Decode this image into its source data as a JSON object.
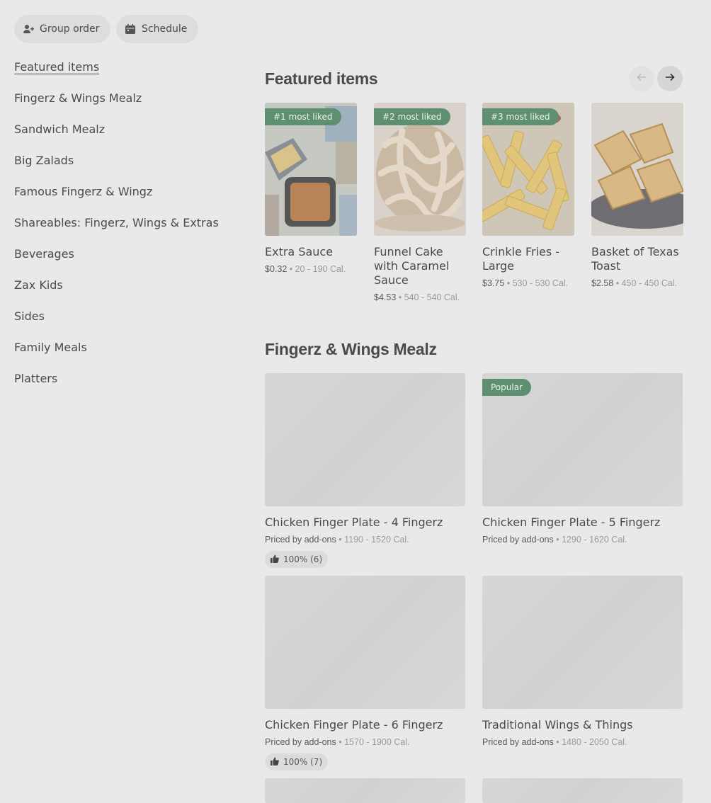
{
  "top_actions": {
    "group_order": "Group order",
    "schedule": "Schedule"
  },
  "sidebar": {
    "items": [
      {
        "label": "Featured items"
      },
      {
        "label": "Fingerz & Wings Mealz"
      },
      {
        "label": "Sandwich Mealz"
      },
      {
        "label": "Big Zalads"
      },
      {
        "label": "Famous Fingerz & Wingz"
      },
      {
        "label": "Shareables: Fingerz, Wings & Extras"
      },
      {
        "label": "Beverages"
      },
      {
        "label": "Zax Kids"
      },
      {
        "label": "Sides"
      },
      {
        "label": "Family Meals"
      },
      {
        "label": "Platters"
      }
    ]
  },
  "featured": {
    "title": "Featured items",
    "items": [
      {
        "badge": "#1 most liked",
        "name": "Extra Sauce",
        "price": "$0.32",
        "cal": "20 - 190 Cal."
      },
      {
        "badge": "#2 most liked",
        "name": "Funnel Cake with Caramel Sauce",
        "price": "$4.53",
        "cal": "540 - 540 Cal."
      },
      {
        "badge": "#3 most liked",
        "name": "Crinkle Fries - Large",
        "price": "$3.75",
        "cal": "530 - 530 Cal."
      },
      {
        "badge": "",
        "name": "Basket of Texas Toast",
        "price": "$2.58",
        "cal": "450 - 450 Cal."
      }
    ]
  },
  "fingerz_section": {
    "title": "Fingerz & Wings Mealz",
    "items": [
      {
        "badge": "",
        "name": "Chicken Finger Plate - 4 Fingerz",
        "price": "Priced by add-ons",
        "cal": "1190 - 1520 Cal.",
        "rating": "100% (6)"
      },
      {
        "badge": "Popular",
        "name": "Chicken Finger Plate - 5 Fingerz",
        "price": "Priced by add-ons",
        "cal": "1290 - 1620 Cal.",
        "rating": ""
      },
      {
        "badge": "",
        "name": "Chicken Finger Plate - 6 Fingerz",
        "price": "Priced by add-ons",
        "cal": "1570 - 1900 Cal.",
        "rating": "100% (7)"
      },
      {
        "badge": "",
        "name": "Traditional Wings & Things",
        "price": "Priced by add-ons",
        "cal": "1480 - 2050 Cal.",
        "rating": ""
      }
    ]
  },
  "icons": {
    "group_order": "person-plus-icon",
    "schedule": "calendar-icon",
    "prev": "arrow-left-icon",
    "next": "arrow-right-icon",
    "thumbs": "thumbs-up-icon"
  },
  "colors": {
    "badge": "#5d8f70",
    "overlay_bg": "#e9e9e9"
  }
}
